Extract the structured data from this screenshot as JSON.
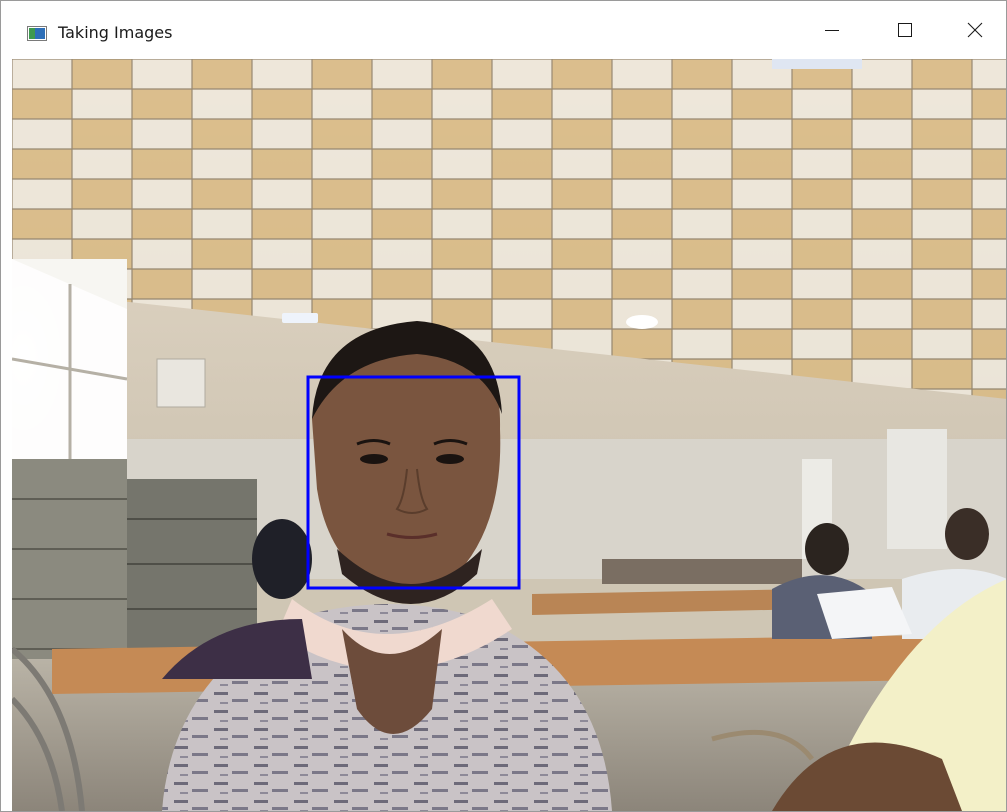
{
  "window": {
    "title": "Taking Images",
    "app_icon": "opencv-window-icon",
    "controls": {
      "minimize_icon": "minimize-icon",
      "maximize_icon": "maximize-icon",
      "close_icon": "close-icon"
    }
  },
  "camera_frame": {
    "scene": "webcam-live-feed",
    "detection_box_color": "#0000ff"
  }
}
